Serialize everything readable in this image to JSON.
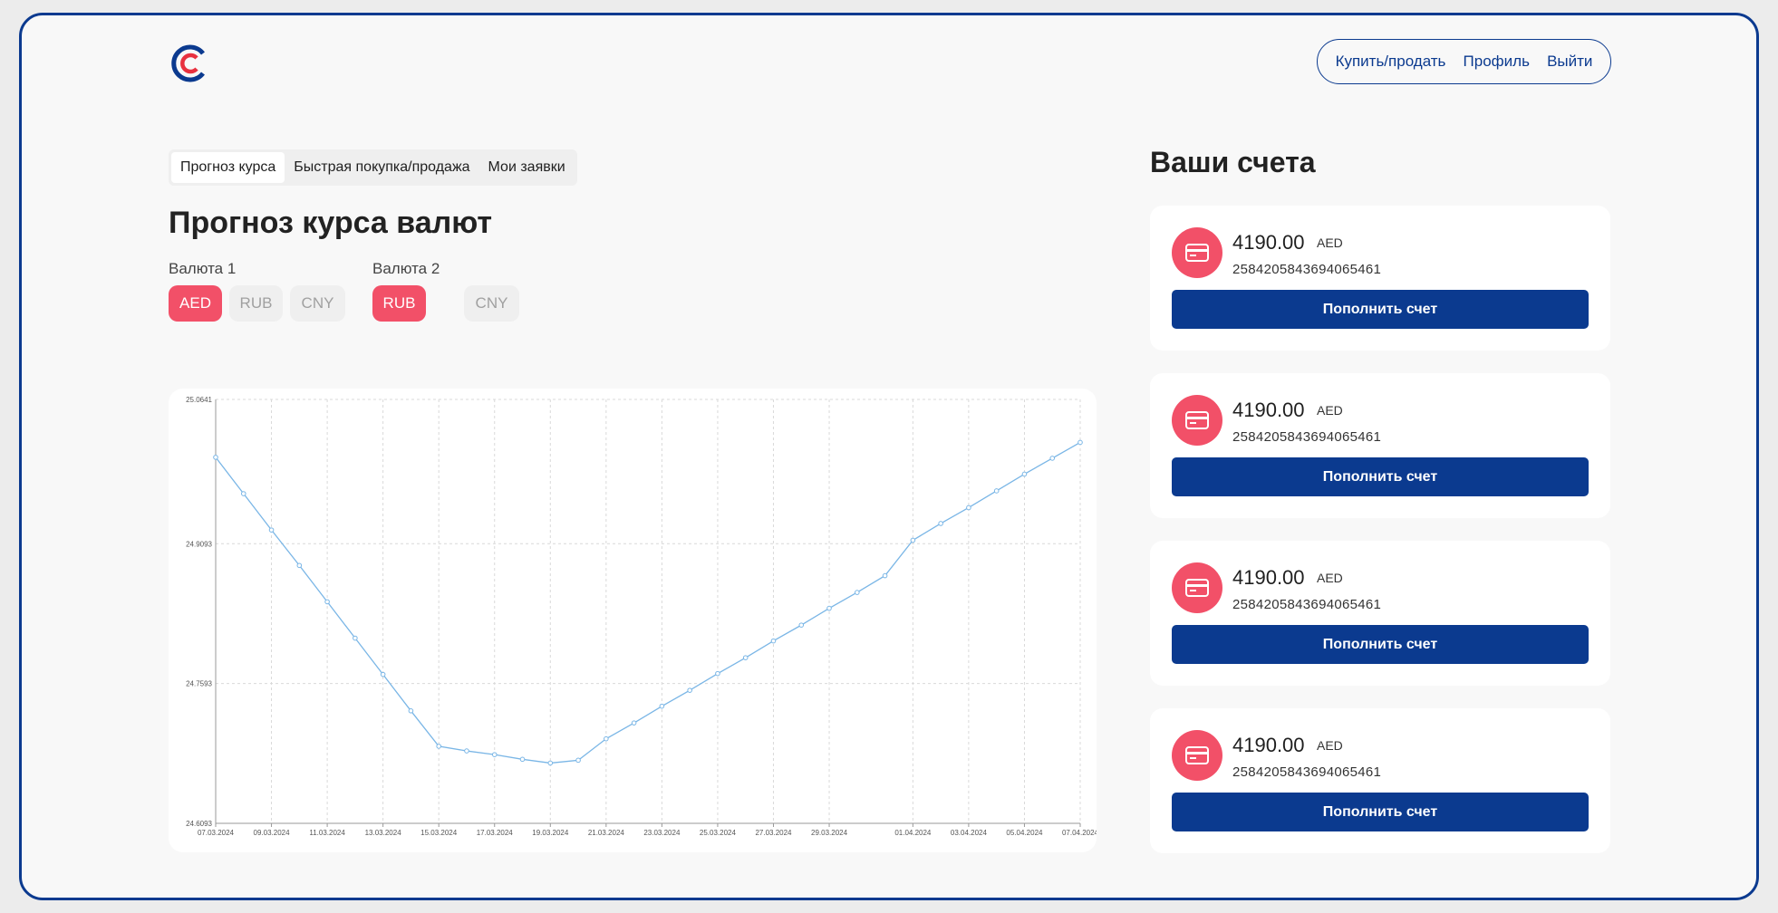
{
  "nav": {
    "buy_sell": "Купить/продать",
    "profile": "Профиль",
    "logout": "Выйти"
  },
  "tabs": [
    {
      "label": "Прогноз курса",
      "active": true
    },
    {
      "label": "Быстрая покупка/продажа",
      "active": false
    },
    {
      "label": "Мои заявки",
      "active": false
    }
  ],
  "page_title": "Прогноз курса валют",
  "currency1": {
    "label": "Валюта 1",
    "options": [
      "AED",
      "RUB",
      "CNY"
    ],
    "selected": "AED"
  },
  "currency2": {
    "label": "Валюта 2",
    "options": [
      "RUB",
      "CNY"
    ],
    "selected": "RUB"
  },
  "colors": {
    "accent": "#f25068",
    "brand": "#0b3a8f",
    "line": "#7ab6e6"
  },
  "accounts_title": "Ваши счета",
  "accounts": [
    {
      "amount": "4190.00",
      "currency": "AED",
      "number": "2584205843694065461",
      "button": "Пополнить счет",
      "icon": "credit-card-icon"
    },
    {
      "amount": "4190.00",
      "currency": "AED",
      "number": "2584205843694065461",
      "button": "Пополнить счет",
      "icon": "credit-card-icon"
    },
    {
      "amount": "4190.00",
      "currency": "AED",
      "number": "2584205843694065461",
      "button": "Пополнить счет",
      "icon": "credit-card-icon"
    },
    {
      "amount": "4190.00",
      "currency": "AED",
      "number": "2584205843694065461",
      "button": "Пополнить счет",
      "icon": "credit-card-icon"
    }
  ],
  "chart_data": {
    "type": "line",
    "grid": true,
    "ylim": [
      24.6093,
      25.0641
    ],
    "yticks": [
      "24.6093",
      "24.7593",
      "24.9093",
      "25.0641"
    ],
    "x": [
      "07.03.2024",
      "08.03.2024",
      "09.03.2024",
      "10.03.2024",
      "11.03.2024",
      "12.03.2024",
      "13.03.2024",
      "14.03.2024",
      "15.03.2024",
      "16.03.2024",
      "17.03.2024",
      "18.03.2024",
      "19.03.2024",
      "20.03.2024",
      "21.03.2024",
      "22.03.2024",
      "23.03.2024",
      "24.03.2024",
      "25.03.2024",
      "26.03.2024",
      "27.03.2024",
      "28.03.2024",
      "29.03.2024",
      "30.03.2024",
      "31.03.2024",
      "01.04.2024",
      "02.04.2024",
      "03.04.2024",
      "04.04.2024",
      "05.04.2024",
      "06.04.2024",
      "07.04.2024"
    ],
    "xticks": [
      "07.03.2024",
      "09.03.2024",
      "11.03.2024",
      "13.03.2024",
      "15.03.2024",
      "17.03.2024",
      "19.03.2024",
      "21.03.2024",
      "23.03.2024",
      "25.03.2024",
      "27.03.2024",
      "29.03.2024",
      "01.04.2024",
      "03.04.2024",
      "05.04.2024",
      "07.04.2024"
    ],
    "series": [
      {
        "values": [
          25.002,
          24.963,
          24.924,
          24.886,
          24.847,
          24.808,
          24.769,
          24.73,
          24.692,
          24.687,
          24.683,
          24.678,
          24.674,
          24.677,
          24.7,
          24.717,
          24.735,
          24.752,
          24.77,
          24.787,
          24.805,
          24.822,
          24.84,
          24.857,
          24.875,
          24.913,
          24.931,
          24.948,
          24.966,
          24.984,
          25.001,
          25.018
        ]
      }
    ]
  }
}
